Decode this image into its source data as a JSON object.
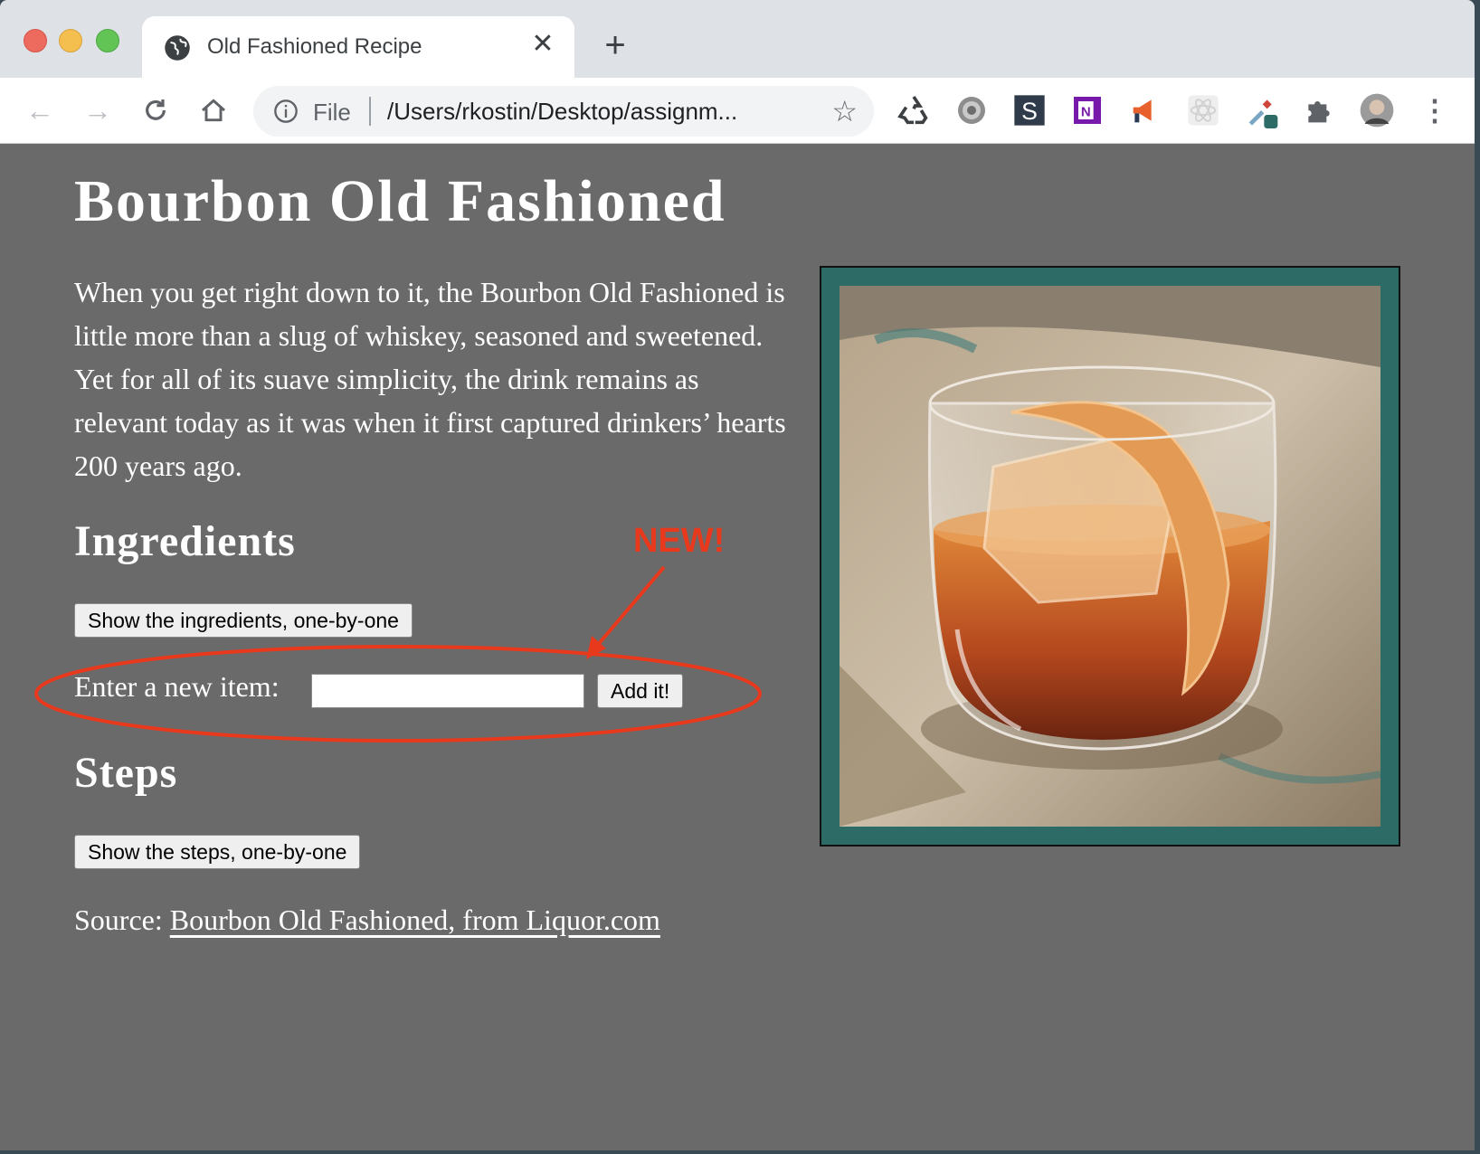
{
  "browser": {
    "tab_title": "Old Fashioned Recipe",
    "omnibox": {
      "scheme_label": "File",
      "url": "/Users/rkostin/Desktop/assignm..."
    },
    "icons": [
      "back-icon",
      "forward-icon",
      "reload-icon",
      "home-icon",
      "info-icon",
      "star-icon",
      "recycle-extension-icon",
      "gear-extension-icon",
      "s-extension-icon",
      "onenote-extension-icon",
      "megaphone-extension-icon",
      "react-extension-icon",
      "eyedropper-extension-icon",
      "puzzle-extension-icon",
      "profile-avatar",
      "kebab-menu-icon"
    ]
  },
  "page": {
    "title": "Bourbon Old Fashioned",
    "intro": "When you get right down to it, the Bourbon Old Fashioned is little more than a slug of whiskey, seasoned and sweetened. Yet for all of its suave simplicity, the drink remains as relevant today as it was when it first captured drinkers’ hearts 200 years ago.",
    "ingredients_heading": "Ingredients",
    "show_ingredients_label": "Show the ingredients, one-by-one",
    "new_item_label": "Enter a new item:",
    "new_item_value": "",
    "add_button_label": "Add it!",
    "steps_heading": "Steps",
    "show_steps_label": "Show the steps, one-by-one",
    "source_prefix": "Source:",
    "source_link": "Bourbon Old Fashioned, from Liquor.com"
  },
  "annotation": {
    "text": "NEW!",
    "color": "#e8391d"
  },
  "colors": {
    "page_background": "#6a6a6a",
    "frame_color": "#2d6b66"
  }
}
